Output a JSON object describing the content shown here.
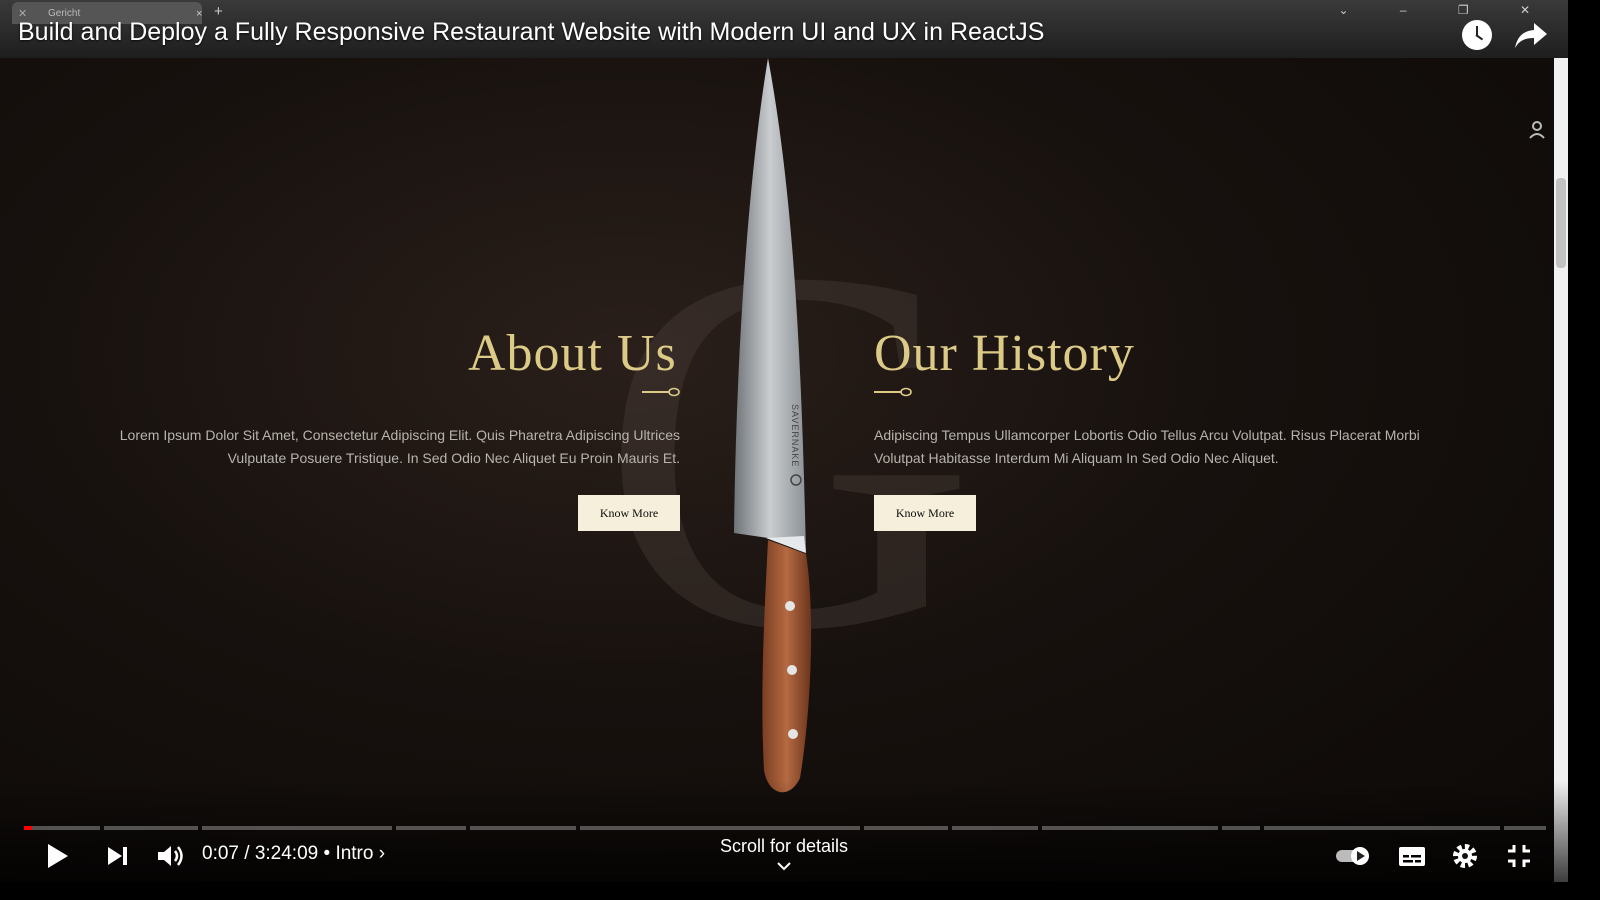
{
  "browser": {
    "tab_title": "Gericht",
    "tab_close": "×",
    "new_tab": "+",
    "window_controls": "⌄ – ❐ ✕"
  },
  "video": {
    "title": "Build and Deploy a Fully Responsive Restaurant Website with Modern UI and UX in ReactJS",
    "time_display": "0:07 / 3:24:09",
    "chapter_separator": "•",
    "chapter": "Intro",
    "chapter_arrow": "›",
    "progress_fraction": 0.0006,
    "scroll_hint": "Scroll for details"
  },
  "site": {
    "watermark_letter": "G",
    "about": {
      "heading": "About Us",
      "text": "Lorem Ipsum Dolor Sit Amet, Consectetur Adipiscing Elit. Quis Pharetra Adipiscing Ultrices Vulputate Posuere Tristique. In Sed Odio Nec Aliquet Eu Proin Mauris Et.",
      "button": "Know More"
    },
    "history": {
      "heading": "Our History",
      "text": "Adipiscing Tempus Ullamcorper Lobortis Odio Tellus Arcu Volutpat. Risus Placerat Morbi Volutpat Habitasse Interdum Mi Aliquam In Sed Odio Nec Aliquet.",
      "button": "Know More"
    },
    "knife_brand": "SAVERNAKE"
  },
  "icons": {
    "play": "play-icon",
    "next": "next-icon",
    "volume": "volume-icon",
    "autoplay": "autoplay-toggle-icon",
    "subtitles": "subtitles-icon",
    "settings": "gear-icon",
    "exit_fullscreen": "exit-fullscreen-icon",
    "watch_later": "clock-icon",
    "share": "share-icon"
  },
  "colors": {
    "accent_gold": "#dcca87",
    "button_bg": "#f5efdb",
    "progress_red": "#ff0000"
  }
}
